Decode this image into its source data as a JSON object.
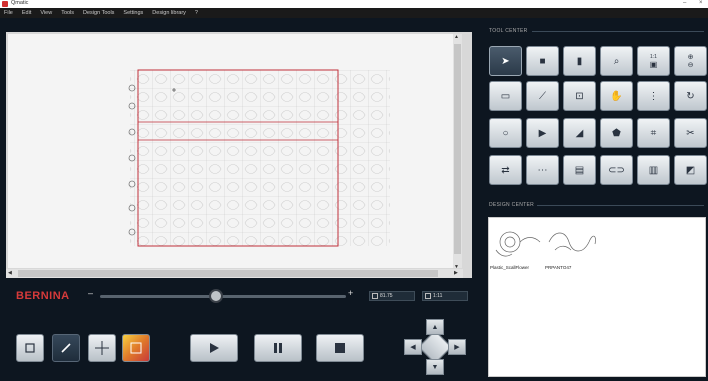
{
  "window": {
    "title": "Qmatic",
    "buttons": [
      "–",
      "×"
    ]
  },
  "menu": [
    "File",
    "Edit",
    "View",
    "Tools",
    "Design Tools",
    "Settings",
    "Design library",
    "?"
  ],
  "brand": "BERNINA",
  "slider": {
    "minus_label": "–",
    "plus_label": "+",
    "position": 0.47
  },
  "readouts": {
    "stitch_count": "81.75",
    "design_count": "1:11"
  },
  "tool_center": {
    "label": "TOOL CENTER",
    "zoom_ratio": "1:1"
  },
  "design_center": {
    "label": "DESIGN CENTER",
    "designs": [
      {
        "name": "Plastic_ScallFlower"
      },
      {
        "name": "PRPANTO47"
      }
    ]
  },
  "icons": {
    "play": "play-icon",
    "pause": "pause-icon",
    "stop": "stop-icon"
  },
  "colors": {
    "brand": "#d63a3a",
    "background": "#0d1620",
    "quilt_border": "#c0303a"
  }
}
